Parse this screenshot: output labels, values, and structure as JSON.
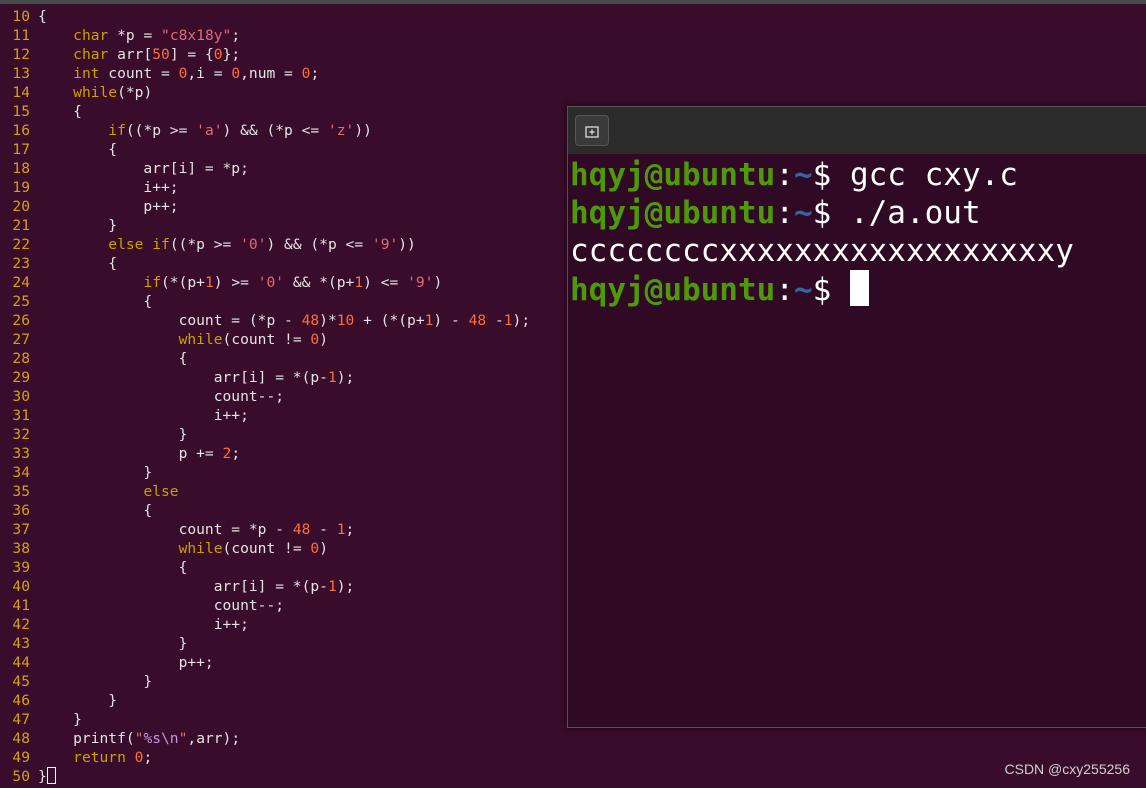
{
  "editor": {
    "lines": [
      {
        "n": "10",
        "t": [
          [
            "p",
            "{"
          ]
        ]
      },
      {
        "n": "11",
        "t": [
          [
            "p",
            "    "
          ],
          [
            "k",
            "char"
          ],
          [
            "p",
            " *p = "
          ],
          [
            "s",
            "\"c8x18y\""
          ],
          [
            "p",
            ";"
          ]
        ]
      },
      {
        "n": "12",
        "t": [
          [
            "p",
            "    "
          ],
          [
            "k",
            "char"
          ],
          [
            "p",
            " arr["
          ],
          [
            "d",
            "50"
          ],
          [
            "p",
            "] = {"
          ],
          [
            "d",
            "0"
          ],
          [
            "p",
            "};"
          ]
        ]
      },
      {
        "n": "13",
        "t": [
          [
            "p",
            "    "
          ],
          [
            "k",
            "int"
          ],
          [
            "p",
            " count = "
          ],
          [
            "d",
            "0"
          ],
          [
            "p",
            ",i = "
          ],
          [
            "d",
            "0"
          ],
          [
            "p",
            ",num = "
          ],
          [
            "d",
            "0"
          ],
          [
            "p",
            ";"
          ]
        ]
      },
      {
        "n": "14",
        "t": [
          [
            "p",
            "    "
          ],
          [
            "k",
            "while"
          ],
          [
            "p",
            "(*p)"
          ]
        ]
      },
      {
        "n": "15",
        "t": [
          [
            "p",
            "    {"
          ]
        ]
      },
      {
        "n": "16",
        "t": [
          [
            "p",
            "        "
          ],
          [
            "k",
            "if"
          ],
          [
            "p",
            "((*p >= "
          ],
          [
            "s",
            "'a'"
          ],
          [
            "p",
            ") && (*p <= "
          ],
          [
            "s",
            "'z'"
          ],
          [
            "p",
            "))"
          ]
        ]
      },
      {
        "n": "17",
        "t": [
          [
            "p",
            "        {"
          ]
        ]
      },
      {
        "n": "18",
        "t": [
          [
            "p",
            "            arr[i] = *p;"
          ]
        ]
      },
      {
        "n": "19",
        "t": [
          [
            "p",
            "            i++;"
          ]
        ]
      },
      {
        "n": "20",
        "t": [
          [
            "p",
            "            p++;"
          ]
        ]
      },
      {
        "n": "21",
        "t": [
          [
            "p",
            "        }"
          ]
        ]
      },
      {
        "n": "22",
        "t": [
          [
            "p",
            "        "
          ],
          [
            "k",
            "else if"
          ],
          [
            "p",
            "((*p >= "
          ],
          [
            "s",
            "'0'"
          ],
          [
            "p",
            ") && (*p <= "
          ],
          [
            "s",
            "'9'"
          ],
          [
            "p",
            "))"
          ]
        ]
      },
      {
        "n": "23",
        "t": [
          [
            "p",
            "        {"
          ]
        ]
      },
      {
        "n": "24",
        "t": [
          [
            "p",
            "            "
          ],
          [
            "k",
            "if"
          ],
          [
            "p",
            "(*(p+"
          ],
          [
            "d",
            "1"
          ],
          [
            "p",
            ") >= "
          ],
          [
            "s",
            "'0'"
          ],
          [
            "p",
            " && *(p+"
          ],
          [
            "d",
            "1"
          ],
          [
            "p",
            ") <= "
          ],
          [
            "s",
            "'9'"
          ],
          [
            "p",
            ")"
          ]
        ]
      },
      {
        "n": "25",
        "t": [
          [
            "p",
            "            {"
          ]
        ]
      },
      {
        "n": "26",
        "t": [
          [
            "p",
            "                count = (*p - "
          ],
          [
            "d",
            "48"
          ],
          [
            "p",
            ")*"
          ],
          [
            "d",
            "10"
          ],
          [
            "p",
            " + (*(p+"
          ],
          [
            "d",
            "1"
          ],
          [
            "p",
            ") - "
          ],
          [
            "d",
            "48"
          ],
          [
            "p",
            " -"
          ],
          [
            "d",
            "1"
          ],
          [
            "p",
            ");"
          ]
        ]
      },
      {
        "n": "27",
        "t": [
          [
            "p",
            "                "
          ],
          [
            "k",
            "while"
          ],
          [
            "p",
            "(count != "
          ],
          [
            "d",
            "0"
          ],
          [
            "p",
            ")"
          ]
        ]
      },
      {
        "n": "28",
        "t": [
          [
            "p",
            "                {"
          ]
        ]
      },
      {
        "n": "29",
        "t": [
          [
            "p",
            "                    arr[i] = *(p-"
          ],
          [
            "d",
            "1"
          ],
          [
            "p",
            ");"
          ]
        ]
      },
      {
        "n": "30",
        "t": [
          [
            "p",
            "                    count--;"
          ]
        ]
      },
      {
        "n": "31",
        "t": [
          [
            "p",
            "                    i++;"
          ]
        ]
      },
      {
        "n": "32",
        "t": [
          [
            "p",
            "                }"
          ]
        ]
      },
      {
        "n": "33",
        "t": [
          [
            "p",
            "                p += "
          ],
          [
            "d",
            "2"
          ],
          [
            "p",
            ";"
          ]
        ]
      },
      {
        "n": "34",
        "t": [
          [
            "p",
            "            }"
          ]
        ]
      },
      {
        "n": "35",
        "t": [
          [
            "p",
            "            "
          ],
          [
            "k",
            "else"
          ]
        ]
      },
      {
        "n": "36",
        "t": [
          [
            "p",
            "            {"
          ]
        ]
      },
      {
        "n": "37",
        "t": [
          [
            "p",
            "                count = *p - "
          ],
          [
            "d",
            "48"
          ],
          [
            "p",
            " - "
          ],
          [
            "d",
            "1"
          ],
          [
            "p",
            ";"
          ]
        ]
      },
      {
        "n": "38",
        "t": [
          [
            "p",
            "                "
          ],
          [
            "k",
            "while"
          ],
          [
            "p",
            "(count != "
          ],
          [
            "d",
            "0"
          ],
          [
            "p",
            ")"
          ]
        ]
      },
      {
        "n": "39",
        "t": [
          [
            "p",
            "                {"
          ]
        ]
      },
      {
        "n": "40",
        "t": [
          [
            "p",
            "                    arr[i] = *(p-"
          ],
          [
            "d",
            "1"
          ],
          [
            "p",
            ");"
          ]
        ]
      },
      {
        "n": "41",
        "t": [
          [
            "p",
            "                    count--;"
          ]
        ]
      },
      {
        "n": "42",
        "t": [
          [
            "p",
            "                    i++;"
          ]
        ]
      },
      {
        "n": "43",
        "t": [
          [
            "p",
            "                }"
          ]
        ]
      },
      {
        "n": "44",
        "t": [
          [
            "p",
            "                p++;"
          ]
        ]
      },
      {
        "n": "45",
        "t": [
          [
            "p",
            "            }"
          ]
        ]
      },
      {
        "n": "46",
        "t": [
          [
            "p",
            "        }"
          ]
        ]
      },
      {
        "n": "47",
        "t": [
          [
            "p",
            "    }"
          ]
        ]
      },
      {
        "n": "48",
        "t": [
          [
            "p",
            "    printf("
          ],
          [
            "s",
            "\""
          ],
          [
            "e",
            "%s\\n"
          ],
          [
            "s",
            "\""
          ],
          [
            "p",
            ",arr);"
          ]
        ]
      },
      {
        "n": "49",
        "t": [
          [
            "p",
            "    "
          ],
          [
            "k",
            "return"
          ],
          [
            "p",
            " "
          ],
          [
            "d",
            "0"
          ],
          [
            "p",
            ";"
          ]
        ]
      },
      {
        "n": "50",
        "t": [
          [
            "p",
            "}"
          ]
        ],
        "cursor": true
      }
    ]
  },
  "terminal": {
    "prompt_user": "hqyj@ubuntu",
    "prompt_sep": ":",
    "prompt_path": "~",
    "prompt_dollar": "$ ",
    "cmd1": "gcc cxy.c",
    "cmd2": "./a.out",
    "output": "ccccccccxxxxxxxxxxxxxxxxxxy"
  },
  "watermark": "CSDN @cxy255256",
  "colors": {
    "background": "#380c2a",
    "prompt_user": "#4e9a06",
    "prompt_path": "#3465a4",
    "line_number": "#d4a017"
  }
}
